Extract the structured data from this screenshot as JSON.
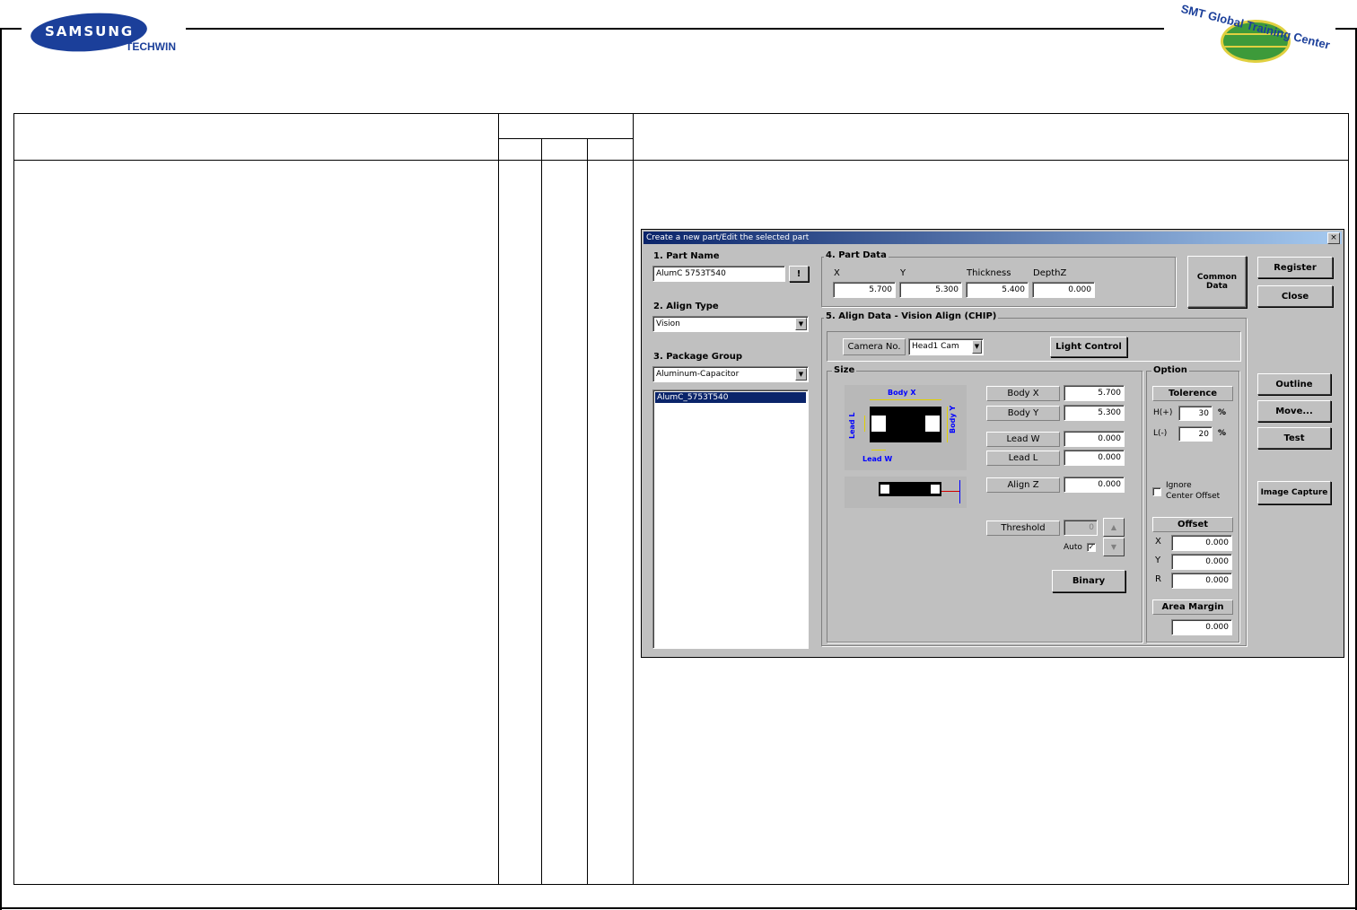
{
  "header": {
    "brand": "SAMSUNG",
    "brand_sub": "TECHWIN",
    "training_center": "SMT Global Training Center"
  },
  "dialog": {
    "title": "Create a new part/Edit the selected part",
    "close_symbol": "×",
    "part_name": {
      "label": "1. Part Name",
      "value": "AlumC 5753T540",
      "button": "!"
    },
    "align_type": {
      "label": "2. Align Type",
      "value": "Vision"
    },
    "package_group": {
      "label": "3. Package Group",
      "value": "Aluminum-Capacitor"
    },
    "part_list": [
      "AlumC_5753T540"
    ],
    "part_data": {
      "label": "4. Part Data",
      "headers": [
        "X",
        "Y",
        "Thickness",
        "DepthZ"
      ],
      "values": [
        "5.700",
        "5.300",
        "5.400",
        "0.000"
      ]
    },
    "align_data": {
      "label": "5. Align Data - Vision Align (CHIP)",
      "camera_label": "Camera No.",
      "camera_value": "Head1 Cam",
      "light_control": "Light Control",
      "size_label": "Size",
      "diagram": {
        "body_x": "Body X",
        "body_y": "Body Y",
        "lead_l": "Lead L",
        "lead_w": "Lead W"
      },
      "body_x": {
        "label": "Body X",
        "value": "5.700"
      },
      "body_y": {
        "label": "Body Y",
        "value": "5.300"
      },
      "lead_w": {
        "label": "Lead W",
        "value": "0.000"
      },
      "lead_l": {
        "label": "Lead L",
        "value": "0.000"
      },
      "align_z": {
        "label": "Align Z",
        "value": "0.000"
      },
      "threshold": {
        "label": "Threshold",
        "value": "0"
      },
      "auto": {
        "label": "Auto",
        "checked": true
      },
      "binary": "Binary"
    },
    "option": {
      "label": "Option",
      "tolerence": "Tolerence",
      "h_label": "H(+)",
      "h_value": "30",
      "l_label": "L(-)",
      "l_value": "20",
      "percent": "%",
      "ignore_line1": "Ignore",
      "ignore_line2": "Center Offset",
      "offset": "Offset",
      "offset_x_label": "X",
      "offset_x": "0.000",
      "offset_y_label": "Y",
      "offset_y": "0.000",
      "offset_r_label": "R",
      "offset_r": "0.000",
      "area_margin": "Area Margin",
      "area_margin_value": "0.000"
    },
    "buttons": {
      "common_data": "Common Data",
      "register": "Register",
      "close": "Close",
      "outline": "Outline",
      "move": "Move...",
      "test": "Test",
      "image_capture": "Image Capture"
    }
  }
}
